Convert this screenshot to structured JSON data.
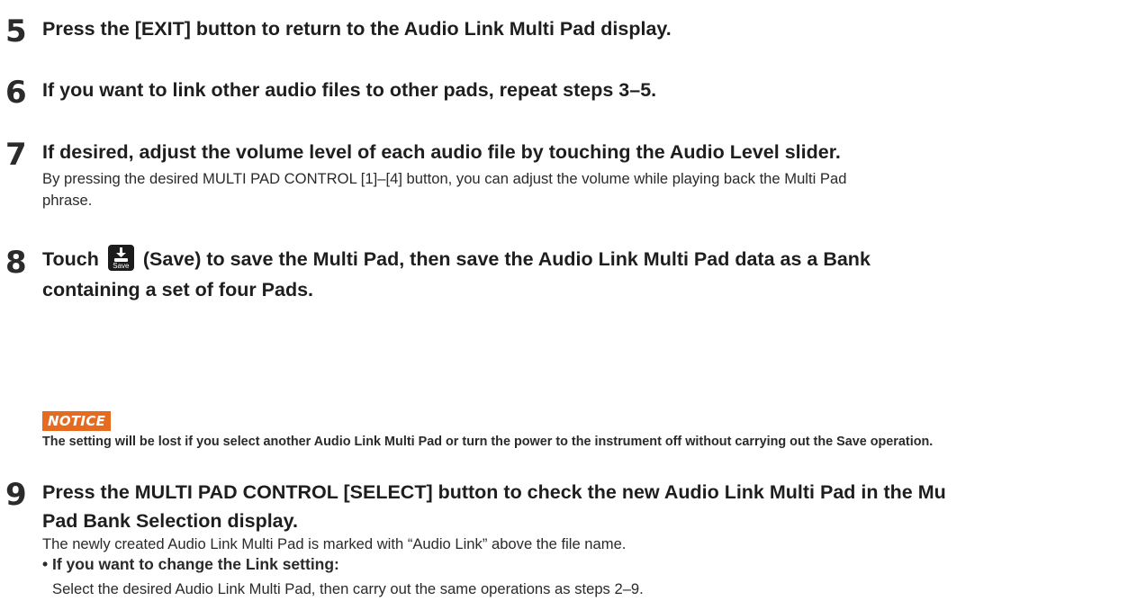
{
  "steps": [
    {
      "number": "5",
      "heading": "Press the [EXIT] button to return to the Audio Link Multi Pad display."
    },
    {
      "number": "6",
      "heading": "If you want to link other audio files to other pads, repeat steps 3–5."
    },
    {
      "number": "7",
      "heading": "If desired, adjust the volume level of each audio file by touching the Audio Level slider.",
      "body_line1": "By pressing the desired MULTI PAD CONTROL [1]–[4] button, you can adjust the volume while playing back the Multi Pad",
      "body_line2": "phrase."
    },
    {
      "number": "8",
      "heading_pre": "Touch",
      "heading_post": "(Save) to save the Multi Pad, then save the Audio Link Multi Pad data as a Bank",
      "heading_line2": "containing a set of four Pads.",
      "icon": "save-icon",
      "icon_label": "Save"
    },
    {
      "number": "9",
      "heading_line1": "Press the MULTI PAD CONTROL [SELECT] button to check the new Audio Link Multi Pad in the Mu",
      "heading_line2": "Pad Bank Selection display.",
      "body": "The newly created Audio Link Multi Pad is marked with “Audio Link” above the file name."
    }
  ],
  "notice": {
    "label": "NOTICE",
    "text": "The setting will be lost if you select another Audio Link Multi Pad or turn the power to the instrument off without carrying out the Save operation."
  },
  "bullet": {
    "title": "• If you want to change the Link setting:",
    "body": "Select the desired Audio Link Multi Pad, then carry out the same operations as steps 2–9."
  },
  "colors": {
    "notice_badge": "#e76b1f",
    "text": "#1e1e1e"
  }
}
